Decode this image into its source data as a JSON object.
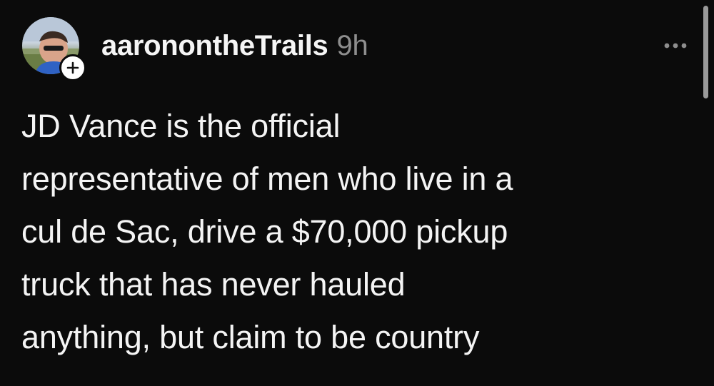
{
  "post": {
    "author": {
      "username": "aaronontheTrails",
      "avatar_icon": "profile-photo",
      "follow_icon": "plus-icon"
    },
    "timestamp": "9h",
    "more_icon": "more-horizontal-icon",
    "body_lines": [
      "JD Vance is the official",
      "representative of men who live in a",
      "cul de Sac, drive a $70,000 pickup",
      "truck that has never hauled",
      "anything, but claim to be country"
    ]
  },
  "colors": {
    "background": "#0b0b0b",
    "text_primary": "#f4f4f4",
    "text_secondary": "#8e8e8e"
  }
}
